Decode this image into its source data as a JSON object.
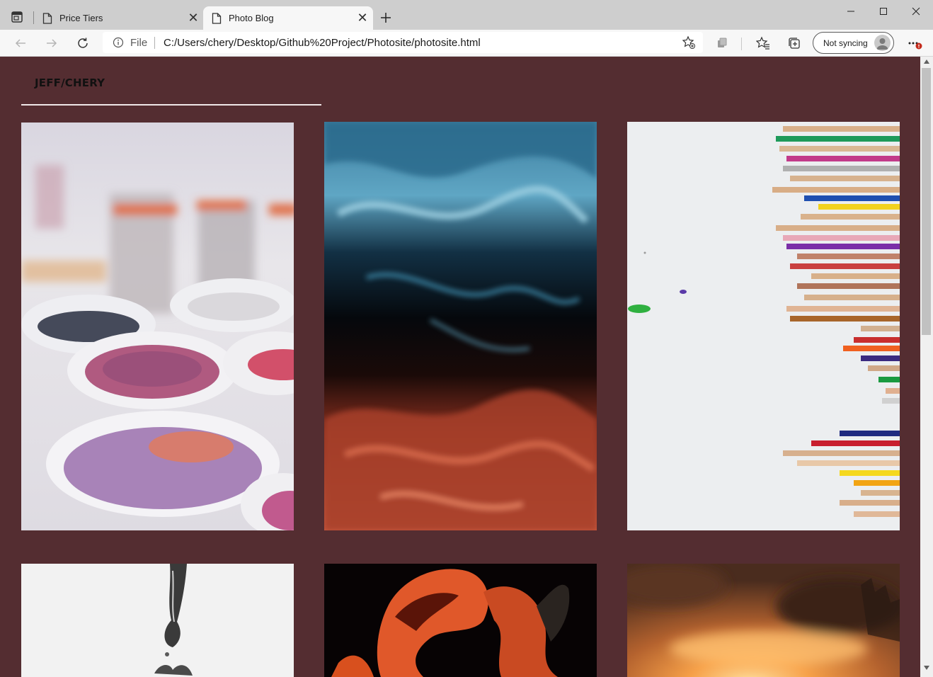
{
  "browser": {
    "tabs": [
      {
        "title": "Price Tiers",
        "active": false
      },
      {
        "title": "Photo Blog",
        "active": true
      }
    ],
    "address": {
      "scheme": "File",
      "url": "C:/Users/chery/Desktop/Github%20Project/Photosite/photosite.html"
    },
    "sync_label": "Not syncing",
    "icons": {
      "tab_actions": "tab-actions-icon",
      "page": "page-icon",
      "close": "close-icon",
      "new_tab": "plus-icon",
      "back": "back-arrow-icon",
      "forward": "forward-arrow-icon",
      "refresh": "refresh-icon",
      "info": "info-icon",
      "favorite_add": "star-add-icon",
      "extensions": "extensions-icon",
      "favorites": "favorites-icon",
      "collections": "collections-icon",
      "menu": "ellipsis-icon"
    }
  },
  "page": {
    "logo": "JEFF/CHERY",
    "background": "#542d31",
    "photos": [
      {
        "subject": "paint bowls"
      },
      {
        "subject": "blue and red fluid art"
      },
      {
        "subject": "colored pencils"
      },
      {
        "subject": "water splash"
      },
      {
        "subject": "orange flower"
      },
      {
        "subject": "sunset clouds"
      }
    ]
  }
}
